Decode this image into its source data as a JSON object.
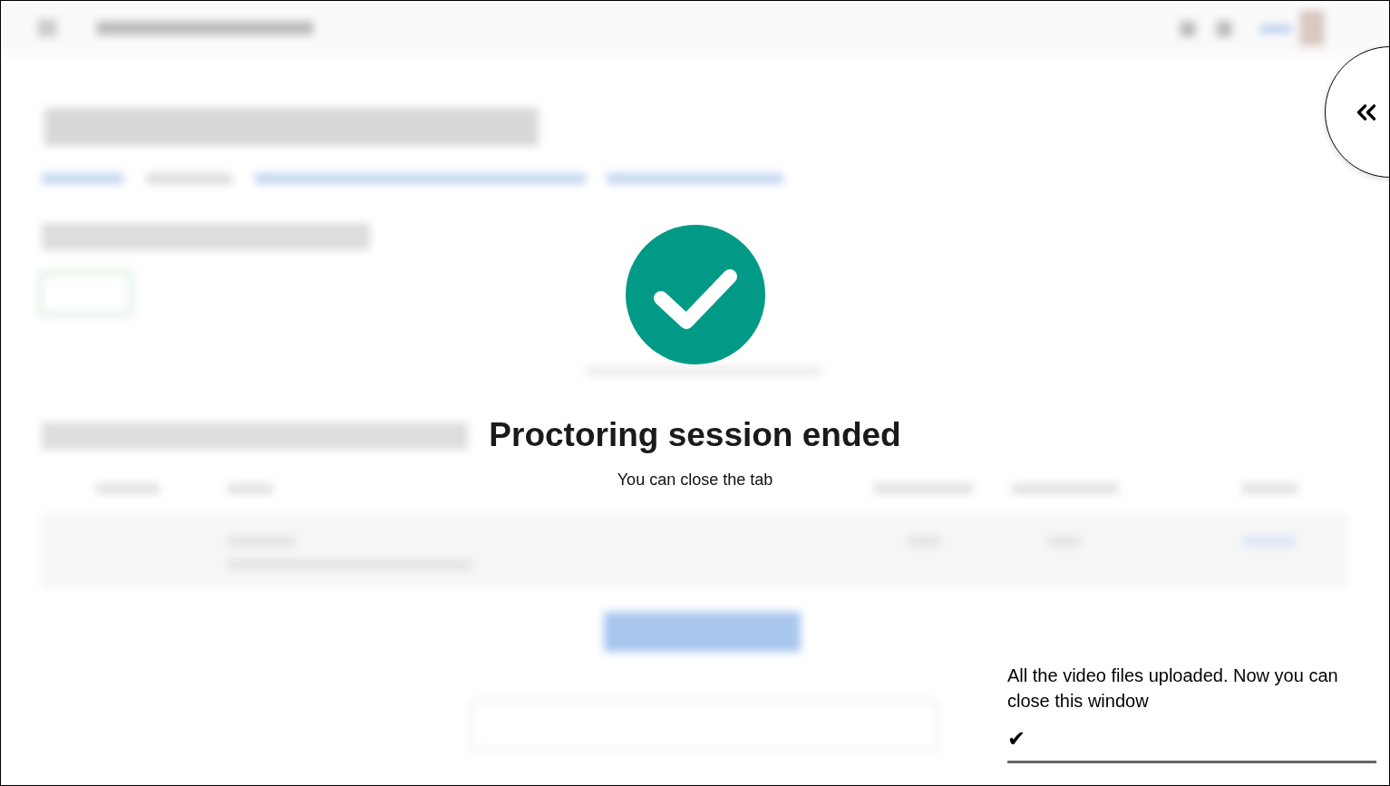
{
  "session": {
    "title": "Proctoring session ended",
    "subtitle": "You can close the tab"
  },
  "panel_toggle": {
    "expanded": false
  },
  "upload": {
    "message": "All the video files uploaded. Now you can close this window",
    "mark": "✔",
    "level": 1
  }
}
